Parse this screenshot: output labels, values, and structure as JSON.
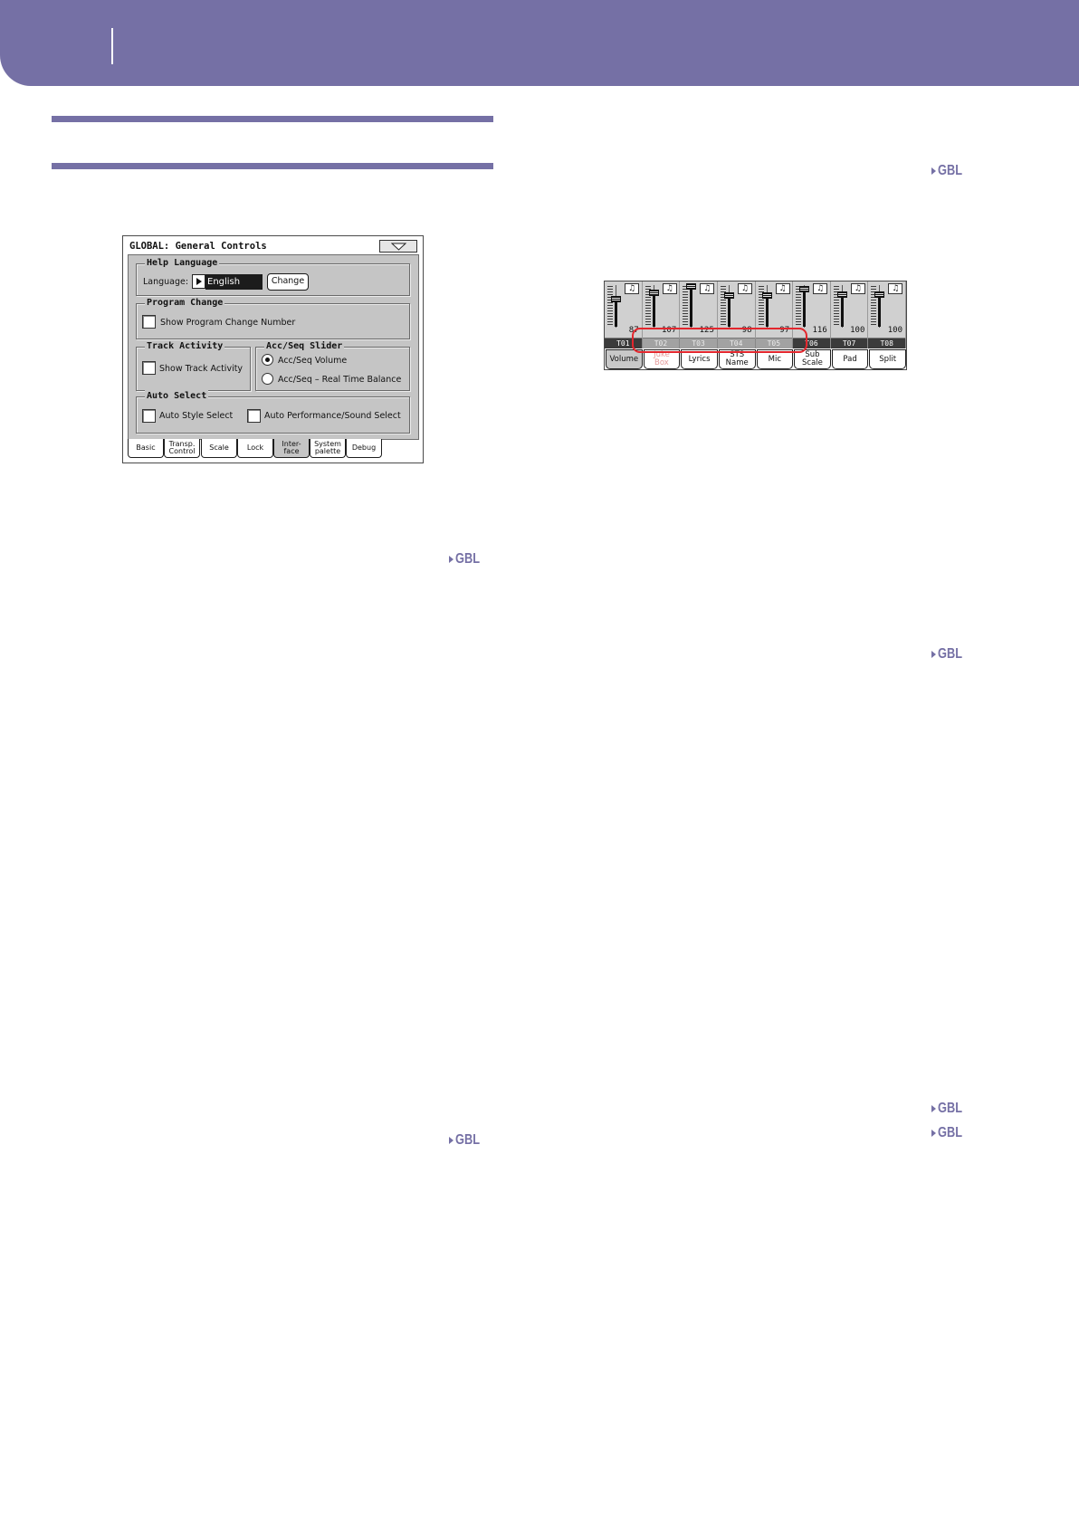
{
  "colors": {
    "accent": "#7570a5",
    "highlight": "#e3262d",
    "disabled_text": "#e59a9a"
  },
  "gbl_markers": [
    {
      "label": "GBL",
      "icon": "triangle-right-icon"
    },
    {
      "label": "GBL",
      "icon": "triangle-right-icon"
    },
    {
      "label": "GBL",
      "icon": "triangle-right-icon"
    },
    {
      "label": "GBL",
      "icon": "triangle-right-icon"
    },
    {
      "label": "GBL",
      "icon": "triangle-right-icon"
    },
    {
      "label": "GBL",
      "icon": "triangle-right-icon"
    }
  ],
  "general_controls": {
    "title": "GLOBAL: General Controls",
    "menu_icon": "dropdown-arrow-icon",
    "help_language": {
      "heading": "Help Language",
      "language_label": "Language:",
      "selector_icon": "triangle-right-icon",
      "language_value": "English",
      "change_button": "Change"
    },
    "program_change": {
      "heading": "Program Change",
      "show_number": {
        "label": "Show Program Change Number",
        "checked": false
      }
    },
    "track_activity": {
      "heading": "Track Activity",
      "show_activity": {
        "label": "Show Track Activity",
        "checked": false
      }
    },
    "acc_seq_slider": {
      "heading": "Acc/Seq Slider",
      "options": [
        {
          "label": "Acc/Seq Volume",
          "selected": true
        },
        {
          "label": "Acc/Seq – Real Time Balance",
          "selected": false
        }
      ]
    },
    "auto_select": {
      "heading": "Auto Select",
      "style": {
        "label": "Auto Style Select",
        "checked": false
      },
      "performance": {
        "label": "Auto Performance/Sound Select",
        "checked": false
      }
    },
    "tabs": [
      {
        "label": "Basic",
        "selected": false
      },
      {
        "label": "Transp.\nControl",
        "selected": false
      },
      {
        "label": "Scale",
        "selected": false
      },
      {
        "label": "Lock",
        "selected": false
      },
      {
        "label": "Inter-\nface",
        "selected": true
      },
      {
        "label": "System\npalette",
        "selected": false
      },
      {
        "label": "Debug",
        "selected": false
      }
    ]
  },
  "mixer": {
    "channel_icon": "note-icon",
    "channels": [
      {
        "track": "T01",
        "value": 87,
        "highlighted": false
      },
      {
        "track": "T02",
        "value": 107,
        "highlighted": true
      },
      {
        "track": "T03",
        "value": 125,
        "highlighted": true
      },
      {
        "track": "T04",
        "value": 98,
        "highlighted": true
      },
      {
        "track": "T05",
        "value": 97,
        "highlighted": true
      },
      {
        "track": "T06",
        "value": 116,
        "highlighted": false
      },
      {
        "track": "T07",
        "value": 100,
        "highlighted": false
      },
      {
        "track": "T08",
        "value": 100,
        "highlighted": false
      }
    ],
    "buttons": [
      {
        "label": "Volume",
        "selected": true,
        "disabled": false
      },
      {
        "label": "Juke\nBox",
        "selected": false,
        "disabled": true
      },
      {
        "label": "Lyrics",
        "selected": false,
        "disabled": false
      },
      {
        "label": "STS\nName",
        "selected": false,
        "disabled": false
      },
      {
        "label": "Mic",
        "selected": false,
        "disabled": false
      },
      {
        "label": "Sub\nScale",
        "selected": false,
        "disabled": false
      },
      {
        "label": "Pad",
        "selected": false,
        "disabled": false
      },
      {
        "label": "Split",
        "selected": false,
        "disabled": false
      }
    ]
  }
}
